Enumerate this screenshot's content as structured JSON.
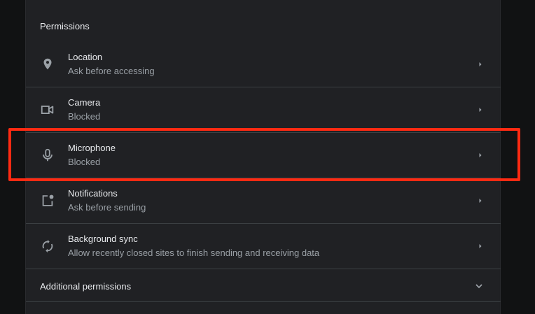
{
  "permissions": {
    "title": "Permissions",
    "items": [
      {
        "label": "Location",
        "status": "Ask before accessing",
        "icon": "location-pin-icon"
      },
      {
        "label": "Camera",
        "status": "Blocked",
        "icon": "camera-icon"
      },
      {
        "label": "Microphone",
        "status": "Blocked",
        "icon": "microphone-icon"
      },
      {
        "label": "Notifications",
        "status": "Ask before sending",
        "icon": "notifications-icon"
      },
      {
        "label": "Background sync",
        "status": "Allow recently closed sites to finish sending and receiving data",
        "icon": "sync-icon"
      }
    ],
    "additional_label": "Additional permissions"
  },
  "colors": {
    "background": "#111213",
    "card": "#202124",
    "text_primary": "#e8eaed",
    "text_secondary": "#9aa0a6",
    "divider": "#3c4043",
    "highlight": "#ff2a12"
  }
}
